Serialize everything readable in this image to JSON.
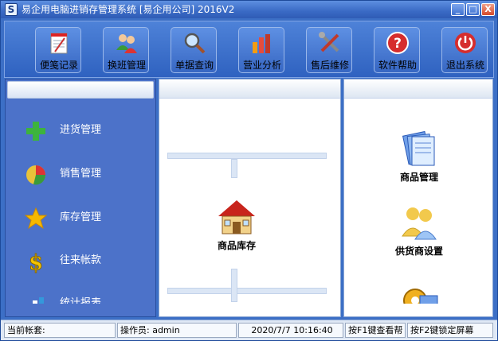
{
  "window": {
    "title": "易企用电脑进销存管理系统 [易企用公司] 2016V2",
    "app_icon_glyph": "S",
    "controls": {
      "minimize": "_",
      "maximize": "□",
      "close": "X"
    }
  },
  "toolbar": {
    "buttons": [
      {
        "label": "便笺记录",
        "icon": "notepad-icon"
      },
      {
        "label": "换班管理",
        "icon": "users-icon"
      },
      {
        "label": "单据查询",
        "icon": "magnifier-icon"
      },
      {
        "label": "营业分析",
        "icon": "bar-chart-icon"
      },
      {
        "label": "售后维修",
        "icon": "tools-icon"
      },
      {
        "label": "软件帮助",
        "icon": "help-icon"
      },
      {
        "label": "退出系统",
        "icon": "power-icon"
      }
    ]
  },
  "sidebar": {
    "items": [
      {
        "label": "进货管理",
        "icon": "green-plus-icon"
      },
      {
        "label": "销售管理",
        "icon": "pie-chart-icon"
      },
      {
        "label": "库存管理",
        "icon": "star-icon"
      },
      {
        "label": "往来帐款",
        "icon": "dollar-icon"
      },
      {
        "label": "统计报表",
        "icon": "report-chart-icon"
      }
    ]
  },
  "main": {
    "center_item": {
      "label": "商品库存",
      "icon": "house-icon"
    },
    "right_items": [
      {
        "label": "商品管理",
        "icon": "documents-icon"
      },
      {
        "label": "供货商设置",
        "icon": "supplier-icon"
      },
      {
        "label": "",
        "icon": "gear-icon"
      }
    ]
  },
  "status": {
    "account": "当前帐套:",
    "operator": "操作员: admin",
    "datetime": "2020/7/7 10:16:40",
    "hint_f1": "按F1键查看帮",
    "hint_f2": "按F2键锁定屏幕"
  },
  "colors": {
    "frame_blue": "#3c6fc6",
    "panel_blue": "#4c72c9",
    "close_red": "#d4482a"
  }
}
